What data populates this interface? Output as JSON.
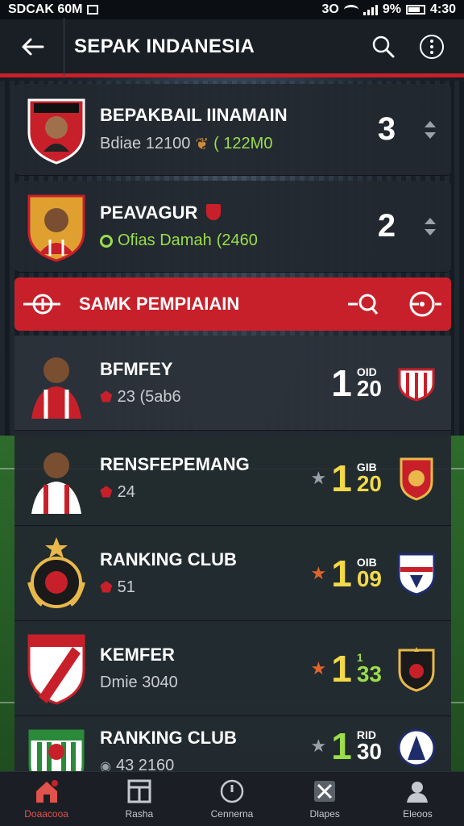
{
  "status_bar": {
    "left_text": "SDCAK 60M",
    "battery": "9%",
    "time": "4:30",
    "signal_text": "3O"
  },
  "app_bar": {
    "title": "SEPAK INDANESIA"
  },
  "top_players": [
    {
      "name": "BEPAKBAIL IINAMAIN",
      "sub_text": "Bdiae 12100",
      "sub_value": "( 122M0",
      "score": "3"
    },
    {
      "name": "PEAVAGUR",
      "sub_text": "Ofias Damah",
      "sub_value": "(2460",
      "score": "2"
    }
  ],
  "section": {
    "label": "SAMK PEMPIAIAIN"
  },
  "ranked": [
    {
      "name": "BFMFEY",
      "sub": "23 (5ab6",
      "value_top": "OID",
      "value_big": "1",
      "value_small": "20",
      "color": "#ffffff"
    },
    {
      "name": "RENSFEPEMANG",
      "sub": "24",
      "value_top": "GIB",
      "value_big": "1",
      "value_small": "20",
      "color": "#f2d94a"
    },
    {
      "name": "RANKING CLUB",
      "sub": "51",
      "value_top": "OIB",
      "value_big": "1",
      "value_small": "09",
      "color": "#f2d94a"
    },
    {
      "name": "KEMFER",
      "sub": "Dmie 3040",
      "value_top": "1",
      "value_big": "1",
      "value_small": "33",
      "color": "#9bdd4a"
    },
    {
      "name": "RANKING CLUB",
      "sub": "43 2160",
      "value_top": "RID",
      "value_big": "1",
      "value_small": "30",
      "color": "#9bdd4a"
    }
  ],
  "bottom_nav": [
    {
      "label": "Doaacooa"
    },
    {
      "label": "Rasha"
    },
    {
      "label": "Cennerna"
    },
    {
      "label": "Dlapes"
    },
    {
      "label": "Eleoos"
    }
  ],
  "colors": {
    "accent": "#c8202a",
    "green": "#9bdd4a",
    "yellow": "#f2d94a",
    "star_orange": "#e0642a"
  }
}
